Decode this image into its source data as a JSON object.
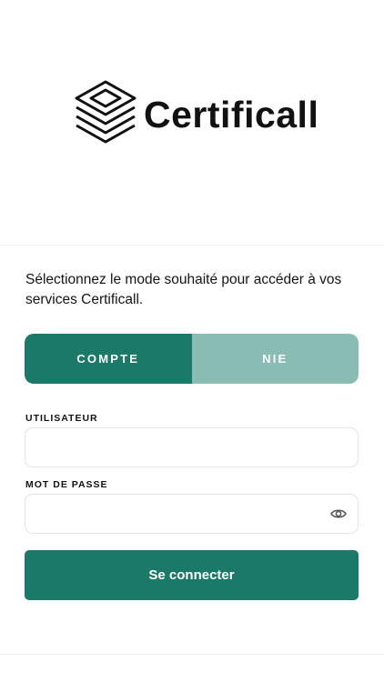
{
  "brand": {
    "name": "Certificall",
    "logo_icon": "layered-stack-logo-icon"
  },
  "intro_text": "Sélectionnez le mode souhaité pour accéder à vos services Certificall.",
  "mode_toggle": {
    "options": [
      "COMPTE",
      "NIE"
    ],
    "selected": "COMPTE"
  },
  "form": {
    "username_label": "UTILISATEUR",
    "username_value": "",
    "password_label": "MOT DE PASSE",
    "password_value": "",
    "password_visibility_icon": "eye-icon",
    "submit_label": "Se connecter"
  },
  "colors": {
    "primary": "#1a7a67",
    "primary_light": "#89bcb2",
    "border": "#e4e4e4",
    "text": "#111111"
  }
}
